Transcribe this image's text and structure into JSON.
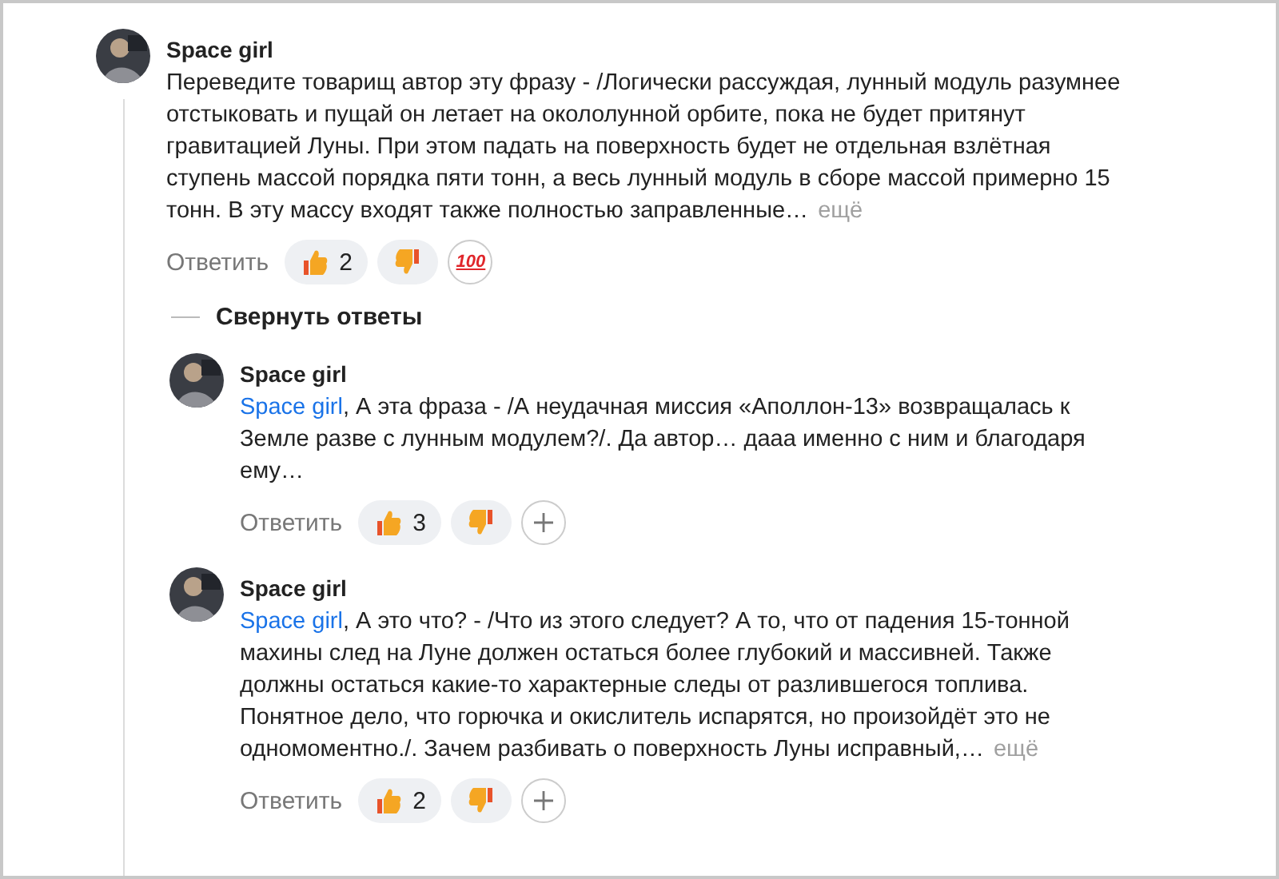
{
  "comment": {
    "author": "Space girl",
    "text": "Переведите товарищ автор эту фразу - /Логически рассуждая, лунный модуль разумнее отстыковать и пущай он летает на окололунной орбите, пока не будет притянут гравитацией Луны. При этом падать на поверхность будет не отдельная взлётная ступень массой порядка пяти тонн, а весь лунный модуль в сборе массой примерно 15 тонн. В эту массу входят также полностью заправленные…",
    "more": "ещё",
    "reply_label": "Ответить",
    "reactions": [
      {
        "kind": "like",
        "count": "2"
      },
      {
        "kind": "dislike"
      },
      {
        "kind": "hundred",
        "label": "100"
      }
    ]
  },
  "collapse_label": "Свернуть ответы",
  "replies": [
    {
      "author": "Space girl",
      "mention": "Space girl",
      "text": ", А эта фраза - /А неудачная миссия «Аполлон-13» возвращалась к Земле разве с лунным модулем?/. Да автор… дааа именно с ним и благодаря ему…",
      "reply_label": "Ответить",
      "reactions": [
        {
          "kind": "like",
          "count": "3"
        },
        {
          "kind": "dislike"
        },
        {
          "kind": "add"
        }
      ]
    },
    {
      "author": "Space girl",
      "mention": "Space girl",
      "text": ", А это что? - /Что из этого следует? А то, что от падения 15-тонной махины след на Луне должен остаться более глубокий и массивней. Также должны остаться какие-то характерные следы от разлившегося топлива. Понятное дело, что горючка и окислитель испарятся, но произойдёт это не одномоментно./. Зачем разбивать о поверхность Луны исправный,…",
      "more": "ещё",
      "reply_label": "Ответить",
      "reactions": [
        {
          "kind": "like",
          "count": "2"
        },
        {
          "kind": "dislike"
        },
        {
          "kind": "add"
        }
      ]
    }
  ]
}
